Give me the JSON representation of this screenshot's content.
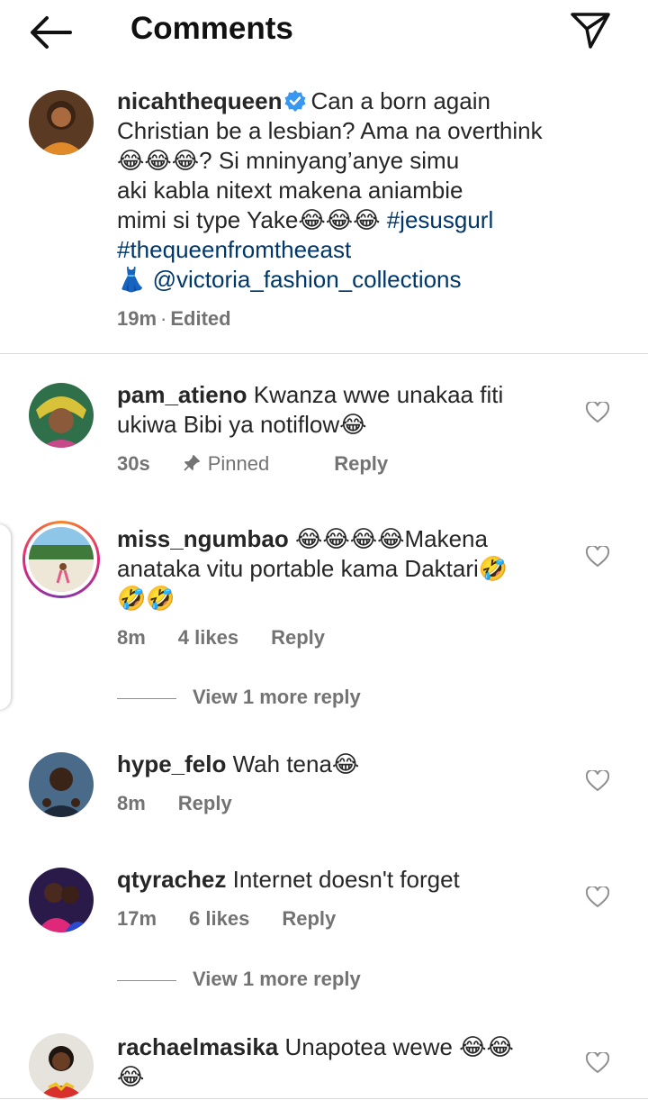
{
  "header": {
    "title": "Comments",
    "back_icon": "arrow-left-icon",
    "send_icon": "paper-plane-icon"
  },
  "caption": {
    "username": "nicahthequeen",
    "verified": true,
    "lines": [
      "Can a born again",
      "Christian be a lesbian? Ama na overthink",
      "😂😂😂? Si mninyang’anye simu",
      "aki kabla nitext makena aniambie",
      "mimi si type Yake😂😂😂"
    ],
    "hashtag1": "#jesusgurl",
    "hashtag2": "#thequeenfromtheeast",
    "mention_prefix": "👗",
    "mention": "@victoria_fashion_collections",
    "time": "19m",
    "separator": "·",
    "edited": "Edited"
  },
  "comments": [
    {
      "username": "pam_atieno",
      "text1": "Kwanza wwe unakaa fiti",
      "text2": "ukiwa  Bibi ya notiflow😂",
      "time": "30s",
      "pinned": "Pinned",
      "reply": "Reply"
    },
    {
      "username": "miss_ngumbao",
      "text1": "😂😂😂😂Makena",
      "text2": "anataka vitu portable kama Daktari🤣",
      "text3": "🤣🤣",
      "time": "8m",
      "likes": "4 likes",
      "reply": "Reply",
      "view_more": "View 1 more reply"
    },
    {
      "username": "hype_felo",
      "text1": "Wah tena😂",
      "time": "8m",
      "reply": "Reply"
    },
    {
      "username": "qtyrachez",
      "text1": "Internet doesn't forget",
      "time": "17m",
      "likes": "6 likes",
      "reply": "Reply",
      "view_more": "View 1 more reply"
    },
    {
      "username": "rachaelmasika",
      "text1": "Unapotea wewe 😂😂",
      "text2": "😂"
    }
  ],
  "colors": {
    "link": "#00376b",
    "meta": "#737373",
    "verified": "#3897f0",
    "text": "#262626"
  }
}
